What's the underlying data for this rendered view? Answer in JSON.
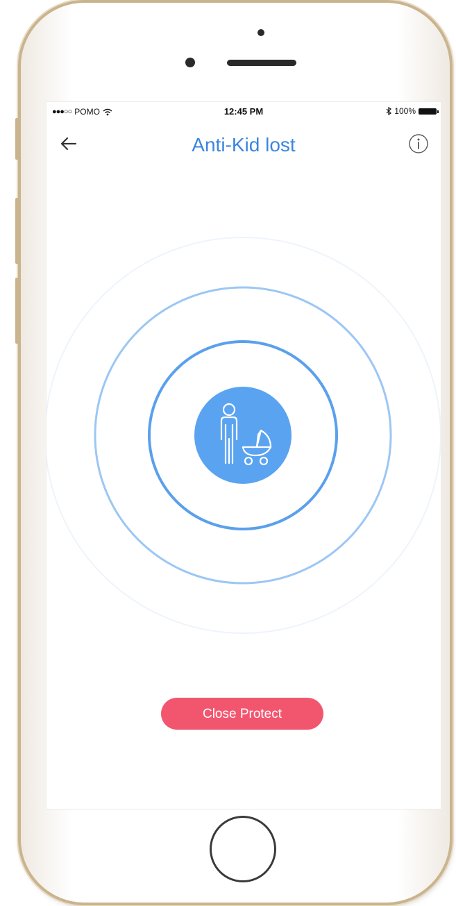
{
  "status_bar": {
    "carrier": "POMO",
    "time": "12:45 PM",
    "battery": "100%"
  },
  "header": {
    "title": "Anti-Kid lost"
  },
  "actions": {
    "close_protect_label": "Close Protect"
  },
  "colors": {
    "accent": "#3a86e0",
    "ring": "#6aa8ee",
    "center_fill": "#5aa3f0",
    "button": "#f2566f"
  },
  "icons": {
    "back": "arrow-left-icon",
    "info": "info-icon",
    "center": "parent-with-stroller-icon"
  }
}
